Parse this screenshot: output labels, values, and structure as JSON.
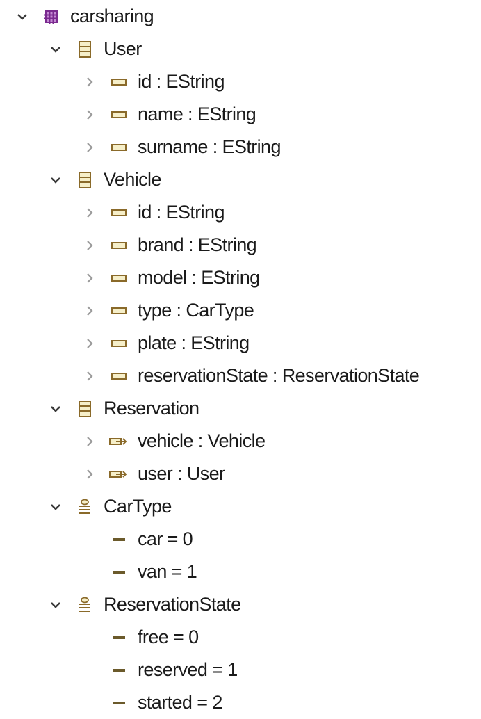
{
  "tree": {
    "package": {
      "label": "carsharing",
      "icon": "package-icon"
    },
    "user": {
      "label": "User",
      "icon": "eclass-icon",
      "attrs": [
        {
          "label": "id : EString",
          "icon": "eattribute-icon"
        },
        {
          "label": "name : EString",
          "icon": "eattribute-icon"
        },
        {
          "label": "surname : EString",
          "icon": "eattribute-icon"
        }
      ]
    },
    "vehicle": {
      "label": "Vehicle",
      "icon": "eclass-icon",
      "attrs": [
        {
          "label": "id : EString",
          "icon": "eattribute-icon"
        },
        {
          "label": "brand : EString",
          "icon": "eattribute-icon"
        },
        {
          "label": "model : EString",
          "icon": "eattribute-icon"
        },
        {
          "label": "type : CarType",
          "icon": "eattribute-icon"
        },
        {
          "label": "plate : EString",
          "icon": "eattribute-icon"
        },
        {
          "label": "reservationState : ReservationState",
          "icon": "eattribute-icon"
        }
      ]
    },
    "reservation": {
      "label": "Reservation",
      "icon": "eclass-icon",
      "refs": [
        {
          "label": "vehicle : Vehicle",
          "icon": "ereference-icon"
        },
        {
          "label": "user : User",
          "icon": "ereference-icon"
        }
      ]
    },
    "cartype": {
      "label": "CarType",
      "icon": "eenum-icon",
      "literals": [
        {
          "label": "car = 0",
          "icon": "eenum-literal-icon"
        },
        {
          "label": "van = 1",
          "icon": "eenum-literal-icon"
        }
      ]
    },
    "reservationstate": {
      "label": "ReservationState",
      "icon": "eenum-icon",
      "literals": [
        {
          "label": "free = 0",
          "icon": "eenum-literal-icon"
        },
        {
          "label": "reserved = 1",
          "icon": "eenum-literal-icon"
        },
        {
          "label": "started = 2",
          "icon": "eenum-literal-icon"
        }
      ]
    }
  },
  "colors": {
    "package": "#7a2a8f",
    "class_border": "#8a6a2a",
    "class_fill": "#f6efc9",
    "attr_border": "#8a6a2a",
    "enum": "#8a6a2a",
    "literal": "#6b5a2b",
    "twistie_open": "#3a3a3a",
    "twistie_closed": "#9a9a9a"
  }
}
